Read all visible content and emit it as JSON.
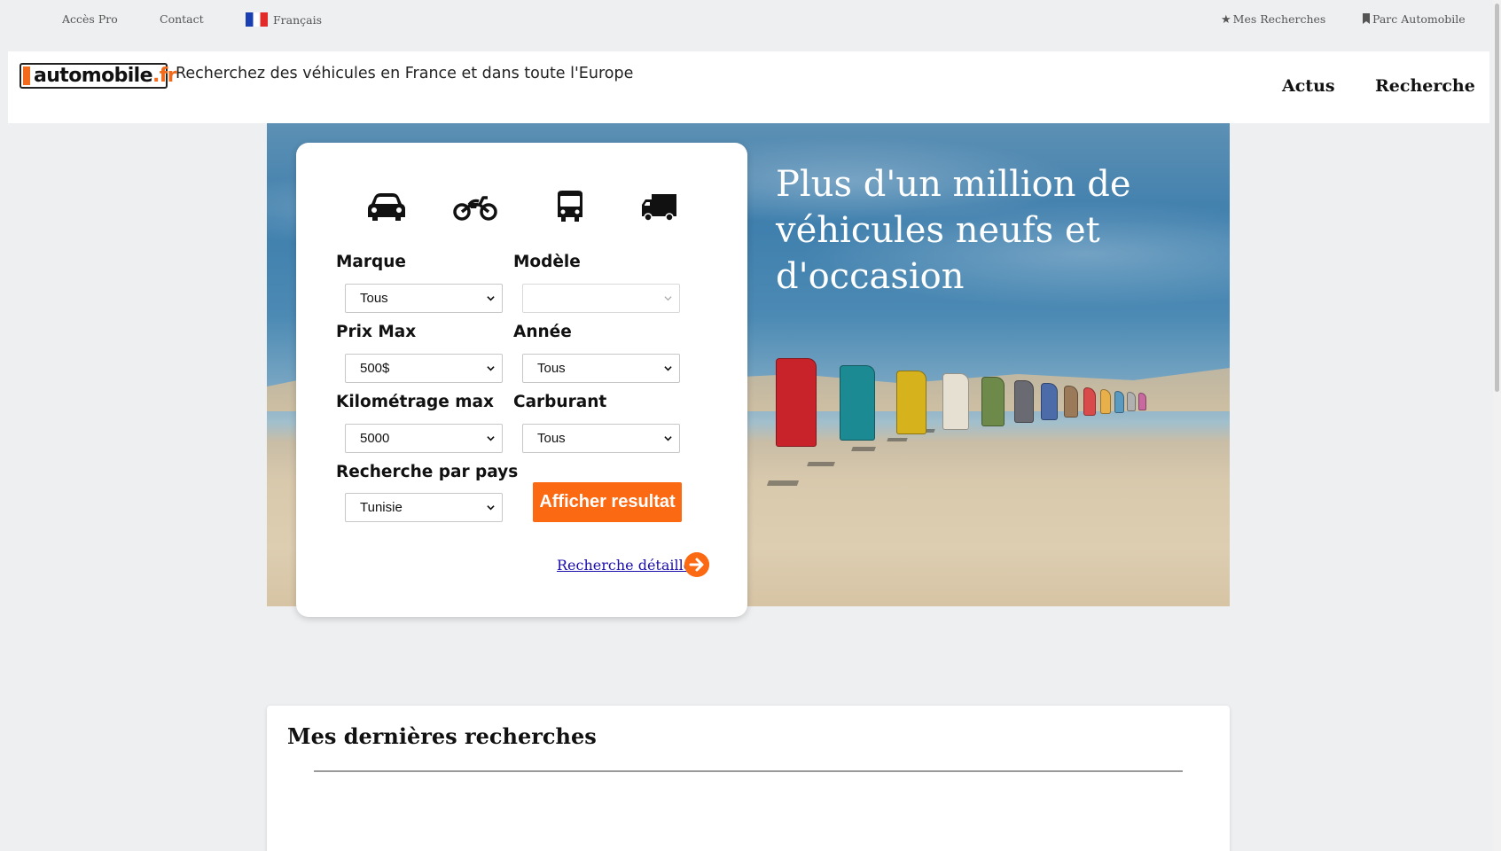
{
  "topbar": {
    "acces_pro": "Accès Pro",
    "contact": "Contact",
    "language": "Français",
    "mes_recherches": "Mes Recherches",
    "parc_automobile": "Parc Automobile"
  },
  "header": {
    "logo_main": "automobile",
    "logo_tld": ".fr",
    "tagline": "Recherchez des véhicules en France et dans toute l'Europe",
    "nav": {
      "actus": "Actus",
      "recherche": "Recherche"
    }
  },
  "hero": {
    "title": "Plus d'un million de véhicules neufs et d'occasion"
  },
  "search": {
    "vehicle_types": [
      "car-icon",
      "motorcycle-icon",
      "bus-icon",
      "truck-icon"
    ],
    "fields": {
      "marque": {
        "label": "Marque",
        "value": "Tous"
      },
      "modele": {
        "label": "Modèle",
        "value": ""
      },
      "prix_max": {
        "label": "Prix Max",
        "value": "500$"
      },
      "annee": {
        "label": "Année",
        "value": "Tous"
      },
      "kilometrage": {
        "label": "Kilométrage max",
        "value": "5000"
      },
      "carburant": {
        "label": "Carburant",
        "value": "Tous"
      },
      "pays": {
        "label": "Recherche par pays",
        "value": "Tunisie"
      }
    },
    "submit_label": "Afficher resultat",
    "detail_link": "Recherche détaillée"
  },
  "recent": {
    "title": "Mes dernières recherches"
  },
  "colors": {
    "accent": "#fb6a12",
    "page_bg": "#eeeff1",
    "link": "#1a0dab"
  }
}
